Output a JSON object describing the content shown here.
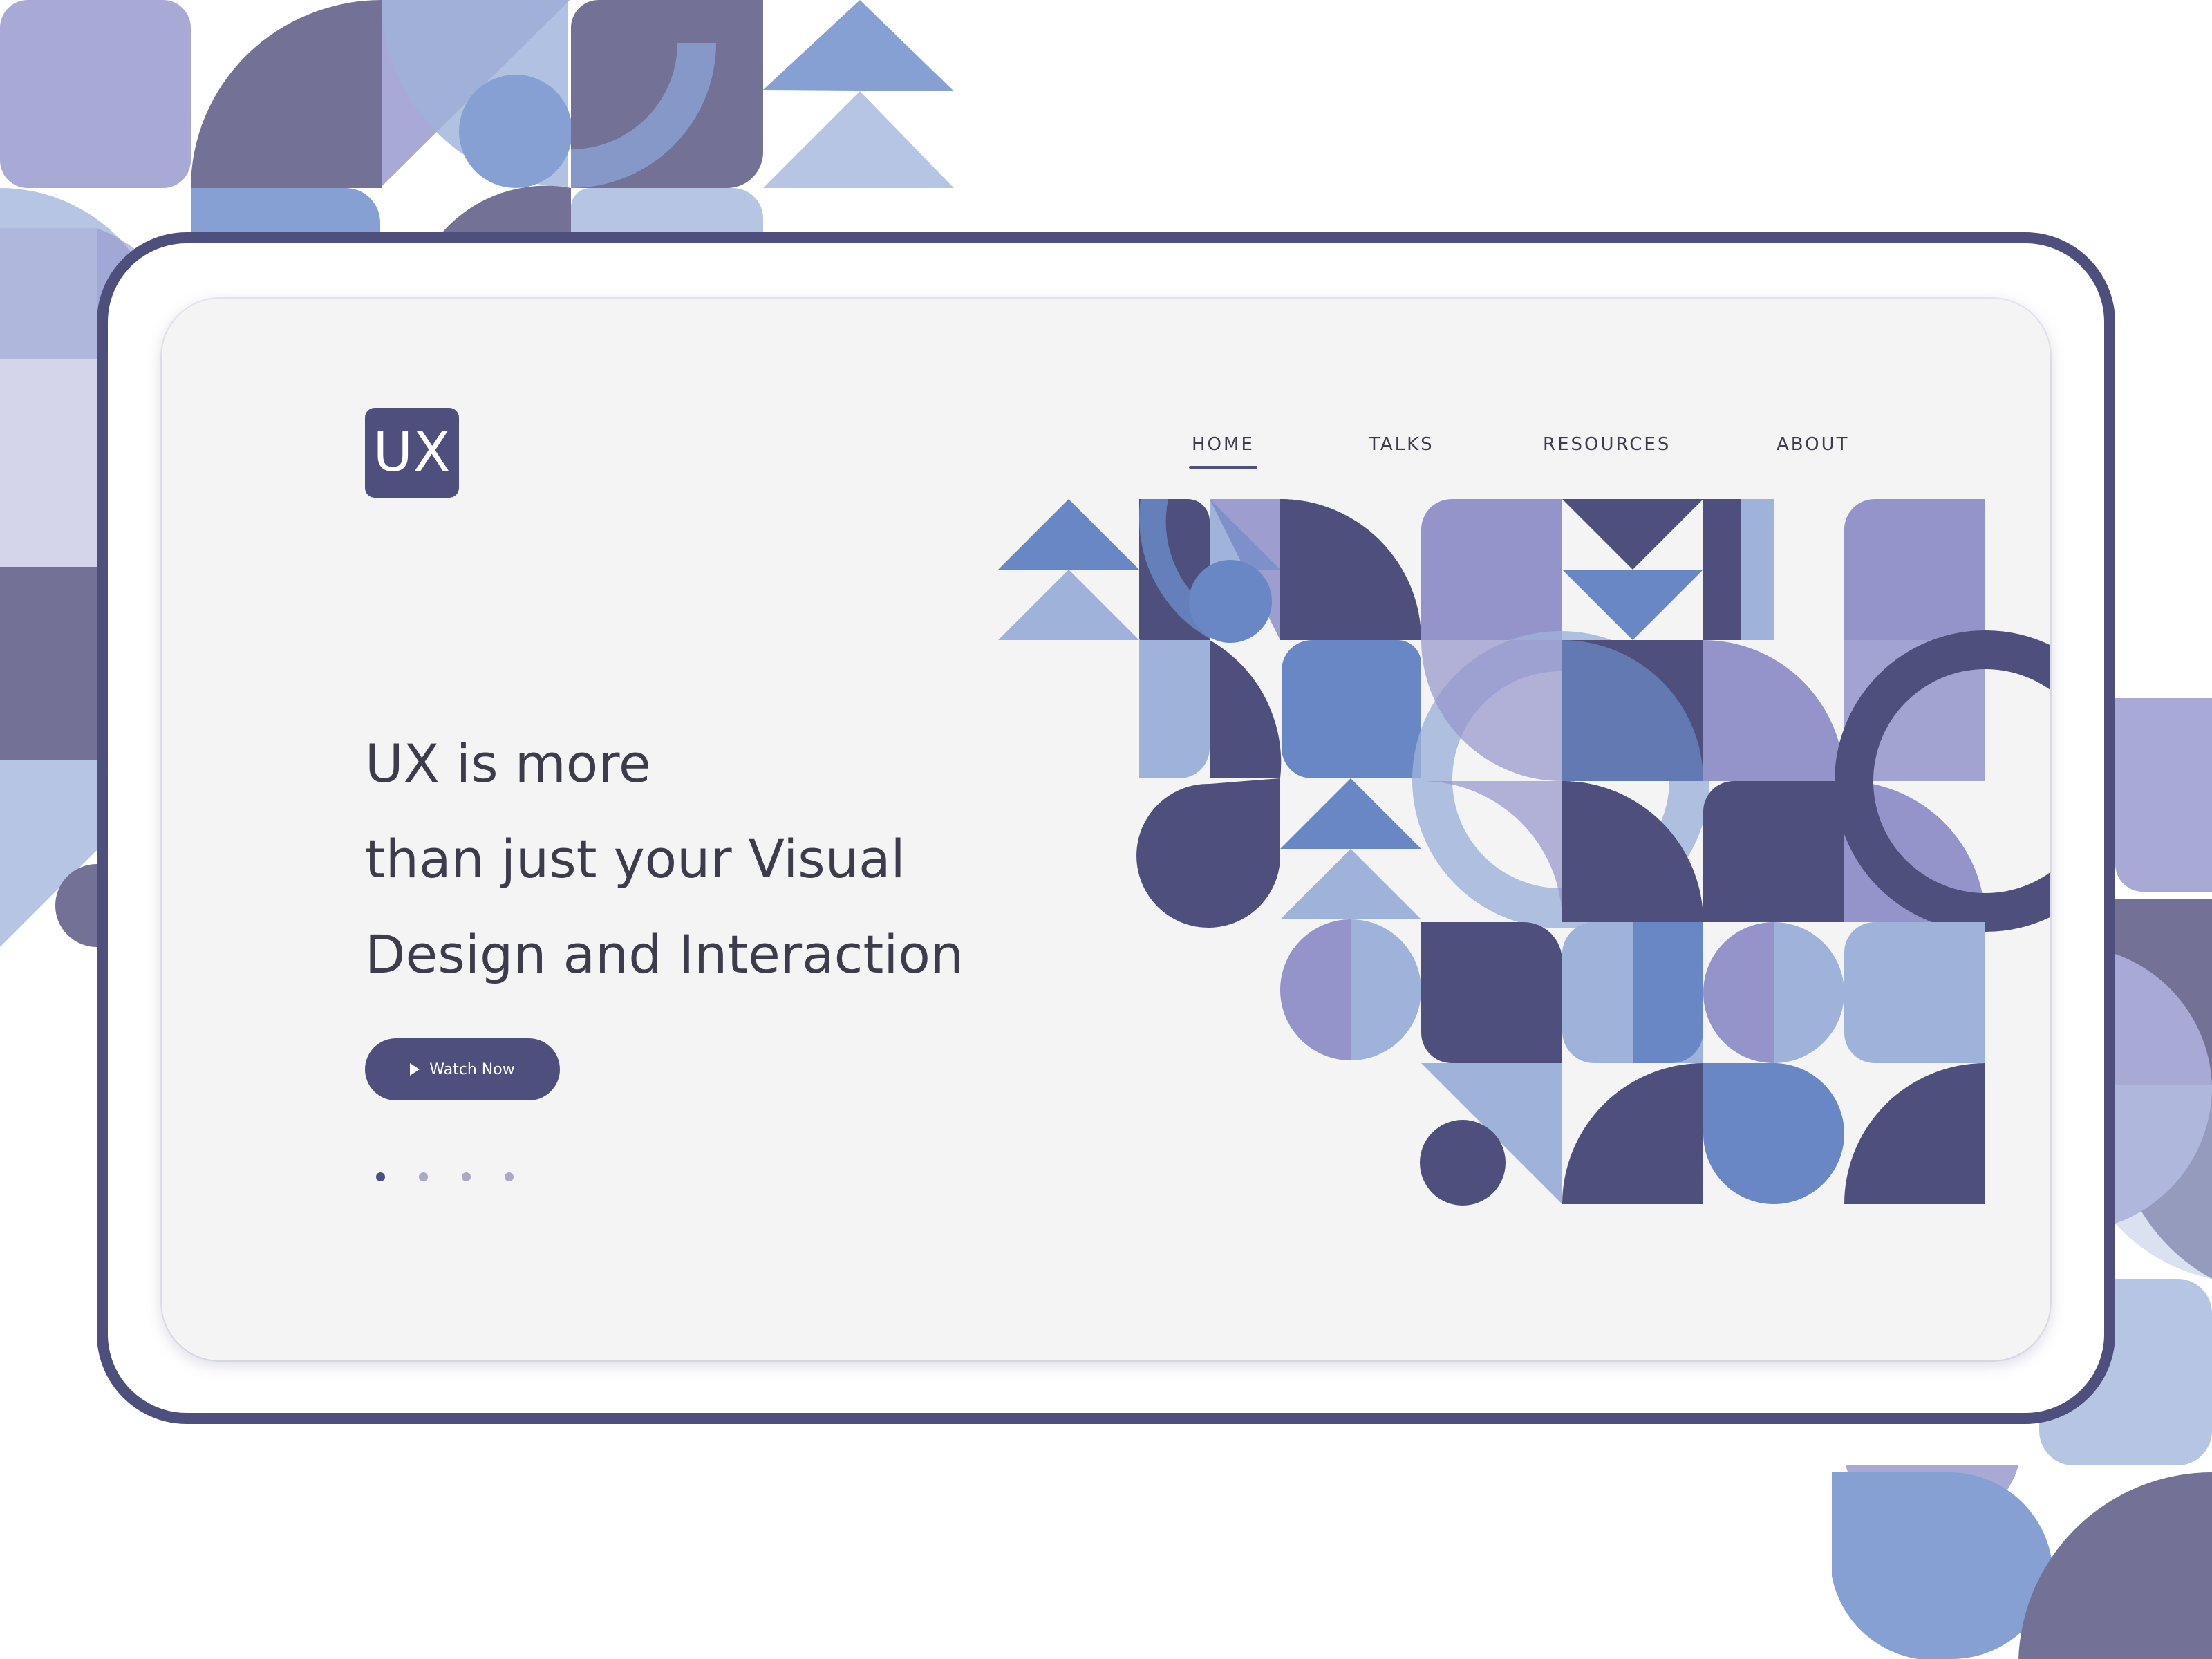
{
  "brand": {
    "logo_text": "UX"
  },
  "nav": [
    {
      "label": "HOME",
      "active": true
    },
    {
      "label": "TALKS",
      "active": false
    },
    {
      "label": "RESOURCES",
      "active": false
    },
    {
      "label": "ABOUT",
      "active": false
    }
  ],
  "hero": {
    "lines": [
      "UX is more",
      "than just your Visual",
      "Design and Interaction"
    ],
    "cta": {
      "label": "Watch Now",
      "icon": "play-icon"
    }
  },
  "carousel": {
    "total": 4,
    "active": 1
  },
  "colors": {
    "navy": "#4f4f7d",
    "slate": "#737196",
    "periwinkle": "#9494cb",
    "blue": "#6887c4",
    "light_blue": "#9eb2da",
    "pale_blue": "#b5c5e3",
    "screen_bg": "#f4f4f5",
    "text": "#3c3c4c"
  }
}
